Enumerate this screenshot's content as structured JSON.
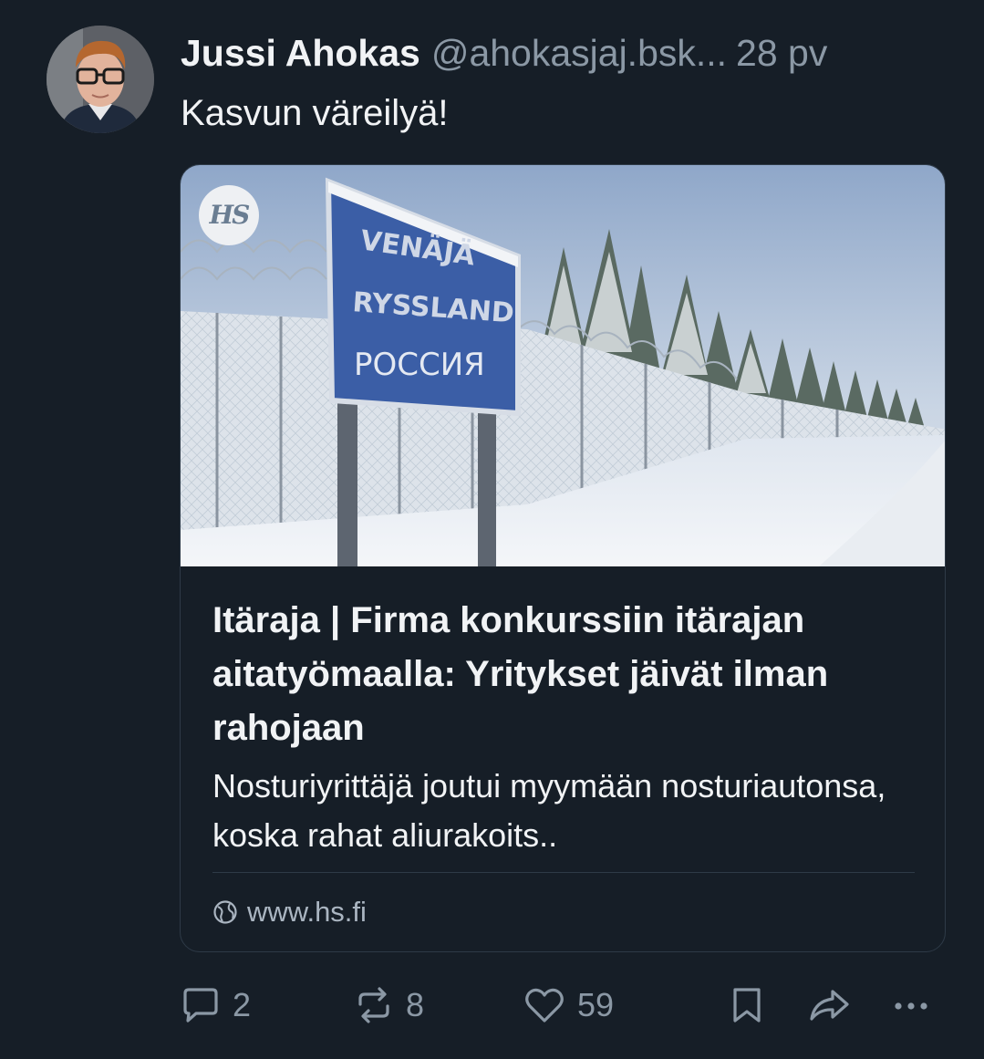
{
  "post": {
    "author_name": "Jussi Ahokas",
    "handle": "@ahokasjaj.bsk...",
    "time": "28 pv",
    "text": "Kasvun väreilyä!"
  },
  "embed": {
    "badge": "HS",
    "image_sign_lines": [
      "VENÄJÄ",
      "RYSSLAND",
      "РОССИЯ"
    ],
    "title": "Itäraja | Firma konkurssiin itärajan aitatyömaalla: Yritykset jäivät ilman rahojaan",
    "description": "Nosturiyrittäjä joutui myymään nosturiautonsa, koska rahat aliurakoits..",
    "url": "www.hs.fi"
  },
  "actions": {
    "reply_count": "2",
    "repost_count": "8",
    "like_count": "59"
  },
  "colors": {
    "background": "#161e27",
    "border": "#2e3a47",
    "text_primary": "#f1f3f5",
    "text_secondary": "#8b98a5"
  },
  "icons": [
    "reply-icon",
    "repost-icon",
    "like-icon",
    "bookmark-icon",
    "share-icon",
    "more-icon",
    "globe-icon"
  ]
}
